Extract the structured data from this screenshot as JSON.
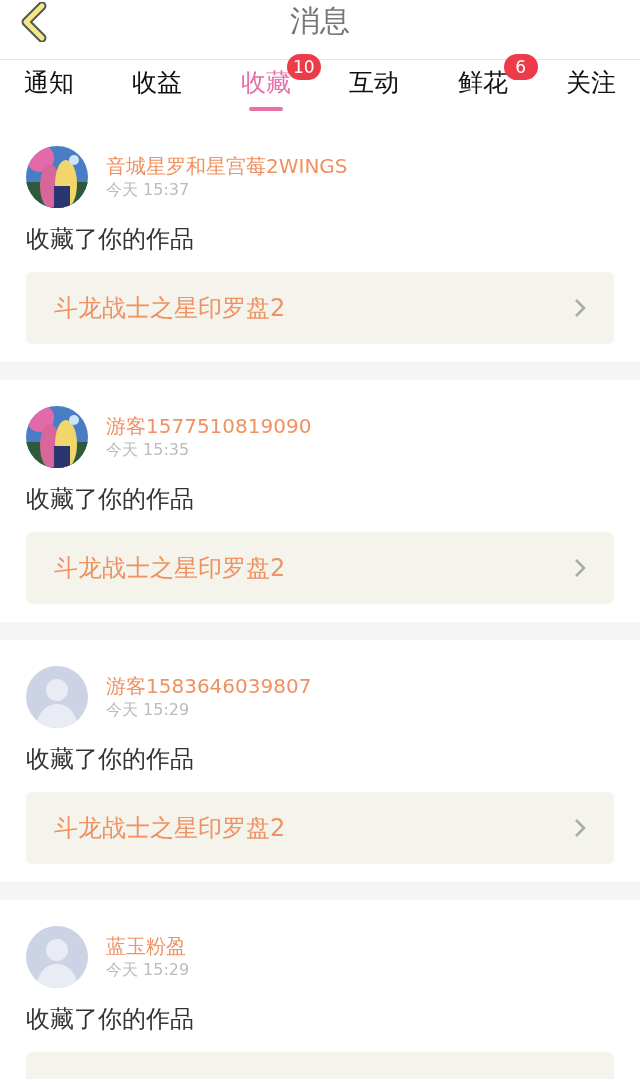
{
  "header": {
    "title": "消息"
  },
  "tabs": [
    {
      "label": "通知",
      "selected": false
    },
    {
      "label": "收益",
      "selected": false
    },
    {
      "label": "收藏",
      "selected": true,
      "badge": "10"
    },
    {
      "label": "互动",
      "selected": false
    },
    {
      "label": "鲜花",
      "selected": false,
      "badge": "6"
    },
    {
      "label": "关注",
      "selected": false
    }
  ],
  "messages": [
    {
      "user": "音城星罗和星宫莓2WINGS",
      "time": "今天 15:37",
      "action": "收藏了你的作品",
      "work": "斗龙战士之星印罗盘2"
    },
    {
      "user": "游客1577510819090",
      "time": "今天 15:35",
      "action": "收藏了你的作品",
      "work": "斗龙战士之星印罗盘2"
    },
    {
      "avatar": {
        "kind": "default"
      },
      "user": "游客1583646039807",
      "time": "今天 15:29",
      "action": "收藏了你的作品",
      "work": "斗龙战士之星印罗盘2"
    },
    {
      "avatar": {
        "kind": "default"
      },
      "user": "蓝玉粉盈",
      "time": "今天 15:29",
      "action": "收藏了你的作品"
    }
  ]
}
